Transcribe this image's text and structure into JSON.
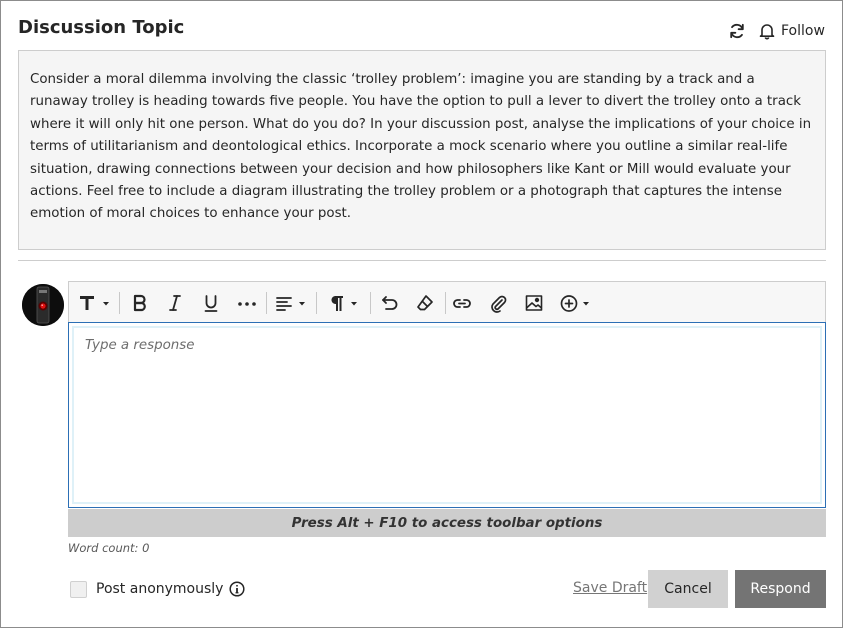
{
  "header": {
    "title": "Discussion Topic",
    "follow_label": "Follow",
    "refresh_icon": "refresh-icon",
    "follow_icon": "bell-icon"
  },
  "prompt": {
    "text": "Consider a moral dilemma involving the classic ‘trolley problem’: imagine you are standing by a track and a runaway trolley is heading towards five people. You have the option to pull a lever to divert the trolley onto a track where it will only hit one person. What do you do? In your discussion post, analyse the implications of your choice in terms of utilitarianism and deontological ethics. Incorporate a mock scenario where you outline a similar real-life situation, drawing connections between your decision and how philosophers like Kant or Mill would evaluate your actions. Feel free to include a diagram illustrating the trolley problem or a photograph that captures the intense emotion of moral choices to enhance your post."
  },
  "editor": {
    "placeholder": "Type a response",
    "value": "",
    "toolbar_icons": [
      "text-format-icon",
      "bold-icon",
      "italic-icon",
      "underline-icon",
      "more-icon",
      "align-icon",
      "paragraph-icon",
      "undo-icon",
      "eraser-icon",
      "link-icon",
      "attach-icon",
      "image-icon",
      "add-content-icon"
    ],
    "toolbar_hint": "Press Alt + F10 to access toolbar options",
    "word_count": "Word count: 0"
  },
  "footer": {
    "anonymous_label": "Post anonymously",
    "anonymous_checked": false,
    "save_draft_label": "Save Draft",
    "cancel_label": "Cancel",
    "respond_label": "Respond"
  },
  "colors": {
    "accent_border": "#2c6fb5",
    "respond_bg": "#747474",
    "cancel_bg": "#d1d1d1",
    "prompt_bg": "#f5f5f5"
  }
}
